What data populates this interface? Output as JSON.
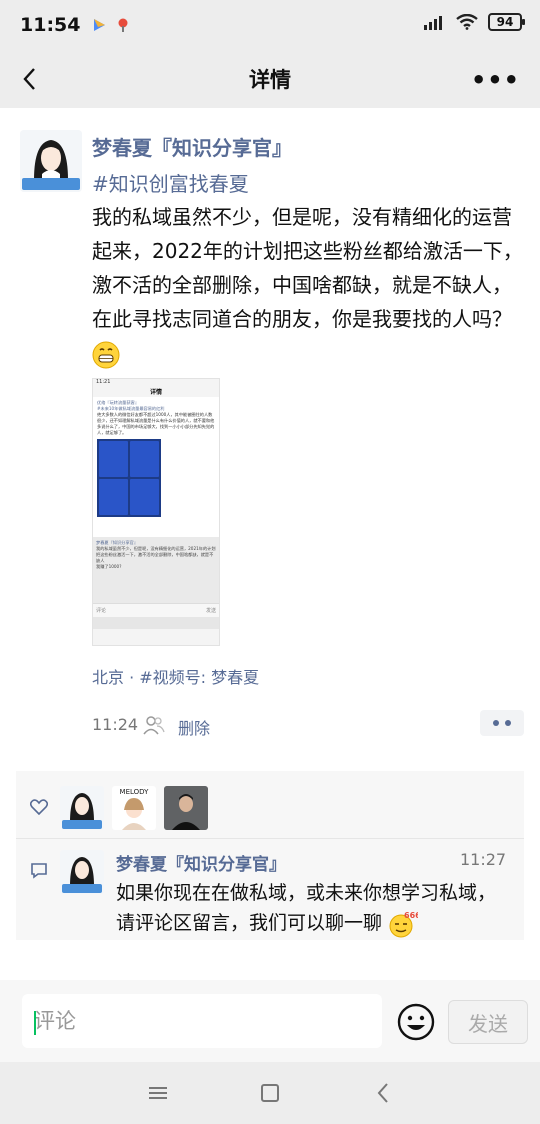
{
  "status_bar": {
    "time": "11:54",
    "battery": "94"
  },
  "nav": {
    "title": "详情",
    "more": "•••"
  },
  "post": {
    "author": "梦春夏『知识分享官』",
    "avatar_badge": "尚学学习",
    "hashtag": "#知识创富找春夏",
    "text": "我的私域虽然不少，但是呢，没有精细化的运营起来，2022年的计划把这些粉丝都给激活一下，激不活的全部删除，中国啥都缺，就是不缺人，在此寻找志同道合的朋友，你是我要找的人吗？",
    "location": "北京 · #视频号: 梦春夏",
    "time": "11:24",
    "delete_label": "删除"
  },
  "thumbnail": {
    "time": "11:21",
    "title": "详情",
    "author": "优络『玩转流量获客』",
    "tag": "#未来10年做私域流量最容易的红利",
    "body": "绝大多数人的微信好友都不超过1000人，其中能被圈住的人数很少，还不如理解私域流量是什么有什么价值的人，就不要和他多说什么了，中国的市场足够大，找到一小小小部分先知先觉的人，就足够了。",
    "comment_author": "梦春夏『知识分享官』",
    "comment_body": "我的私域虽然不少，但是呢，没有精细化的运营，2021年的计划把这些粉丝激活一下，激不活的全部删除，中国啥都缺，就是不缺人",
    "reply": "我赚了1000?",
    "input_placeholder": "评论",
    "send": "发送"
  },
  "likes": {
    "avatars": [
      "avatar-1",
      "avatar-melody",
      "avatar-man"
    ],
    "melody_label": "MELODY"
  },
  "comment": {
    "author": "梦春夏『知识分享官』",
    "time": "11:27",
    "text": "如果你现在在做私域，或未来你想学习私域，请评论区留言，我们可以聊一聊",
    "emoji_label": "666"
  },
  "input": {
    "placeholder": "评论",
    "send": "发送"
  },
  "colors": {
    "link": "#576b95",
    "bg": "#ededed",
    "accent": "#07c160"
  }
}
